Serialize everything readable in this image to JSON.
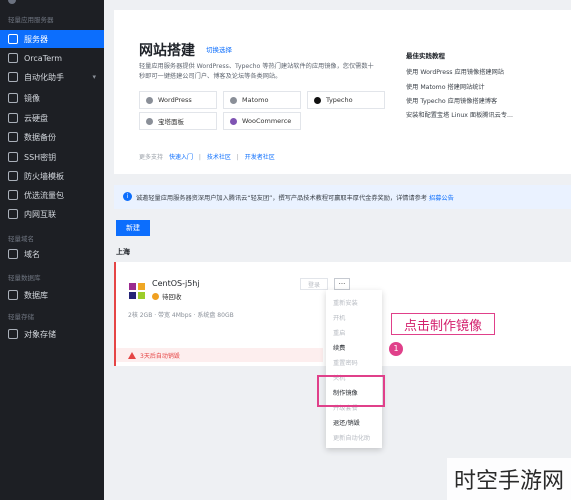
{
  "sidebar": {
    "group_servers": "轻量应用服务器",
    "items": [
      {
        "label": "服务器",
        "icon": "server-icon"
      },
      {
        "label": "OrcaTerm",
        "icon": "terminal-icon"
      },
      {
        "label": "自动化助手",
        "icon": "robot-icon",
        "arrow": "▾"
      },
      {
        "label": "镜像",
        "icon": "image-icon"
      },
      {
        "label": "云硬盘",
        "icon": "disk-icon"
      },
      {
        "label": "数据备份",
        "icon": "backup-icon"
      },
      {
        "label": "SSH密钥",
        "icon": "key-icon"
      },
      {
        "label": "防火墙模板",
        "icon": "firewall-icon"
      },
      {
        "label": "优选流量包",
        "icon": "traffic-icon"
      },
      {
        "label": "内网互联",
        "icon": "network-icon"
      }
    ],
    "group_domain": "轻量域名",
    "domain_item": {
      "label": "域名",
      "icon": "domain-icon"
    },
    "group_db": "轻量数据库",
    "db_item": {
      "label": "数据库",
      "icon": "database-icon"
    },
    "group_storage": "轻量存储",
    "storage_item": {
      "label": "对象存储",
      "icon": "storage-icon"
    }
  },
  "site_builder": {
    "title": "网站搭建",
    "switch_label": "切换选择",
    "description": "轻量应用服务器提供 WordPress、Typecho 等热门建站软件的应用镜像，您仅需数十秒即可一键搭建公司门户、博客及论坛等各类网站。",
    "apps": [
      "WordPress",
      "Matomo",
      "Typecho",
      "宝塔面板",
      "WooCommerce"
    ],
    "more_support": "更多支持",
    "quick_start": "快速入门",
    "tech_community": "技术社区",
    "dev_community": "开发者社区",
    "tutorials_title": "最佳实践教程",
    "tutorials": [
      "使用 WordPress 应用镜像搭建网站",
      "使用 Matomo 搭建网站统计",
      "使用 Typecho 应用镜像搭建博客",
      "安装和配置宝塔 Linux 面板腾讯云专..."
    ]
  },
  "notice": {
    "text": "诚邀轻量应用服务器资深用户加入腾讯云“轻友团”，撰写产品技术教程可赢取丰厚代金券奖励，详情请参考",
    "link": "招募公告"
  },
  "new_button": "新建",
  "region": "上海",
  "instance": {
    "name": "CentOS-j5hj",
    "status": "待回收",
    "spec": "2核 2GB · 带宽 4Mbps · 系统盘 80GB",
    "login": "登录",
    "more": "···",
    "warning": "3天后自动销毁",
    "renew": "续"
  },
  "context_menu": [
    {
      "label": "重新安装",
      "enabled": false
    },
    {
      "label": "开机",
      "enabled": false
    },
    {
      "label": "重启",
      "enabled": false
    },
    {
      "label": "续费",
      "enabled": true
    },
    {
      "label": "重置密码",
      "enabled": false
    },
    {
      "label": "关机",
      "enabled": false
    },
    {
      "label": "制作镜像",
      "enabled": true
    },
    {
      "label": "升级套餐",
      "enabled": false
    },
    {
      "label": "退还/销毁",
      "enabled": true
    },
    {
      "label": "更新自动化助",
      "enabled": false
    }
  ],
  "annotation": {
    "callout": "点击制作镜像",
    "badge": "1"
  },
  "watermark": "时空手游网",
  "colors": {
    "accent": "#0c6efd",
    "warning": "#e54545",
    "highlight": "#e0408a"
  }
}
